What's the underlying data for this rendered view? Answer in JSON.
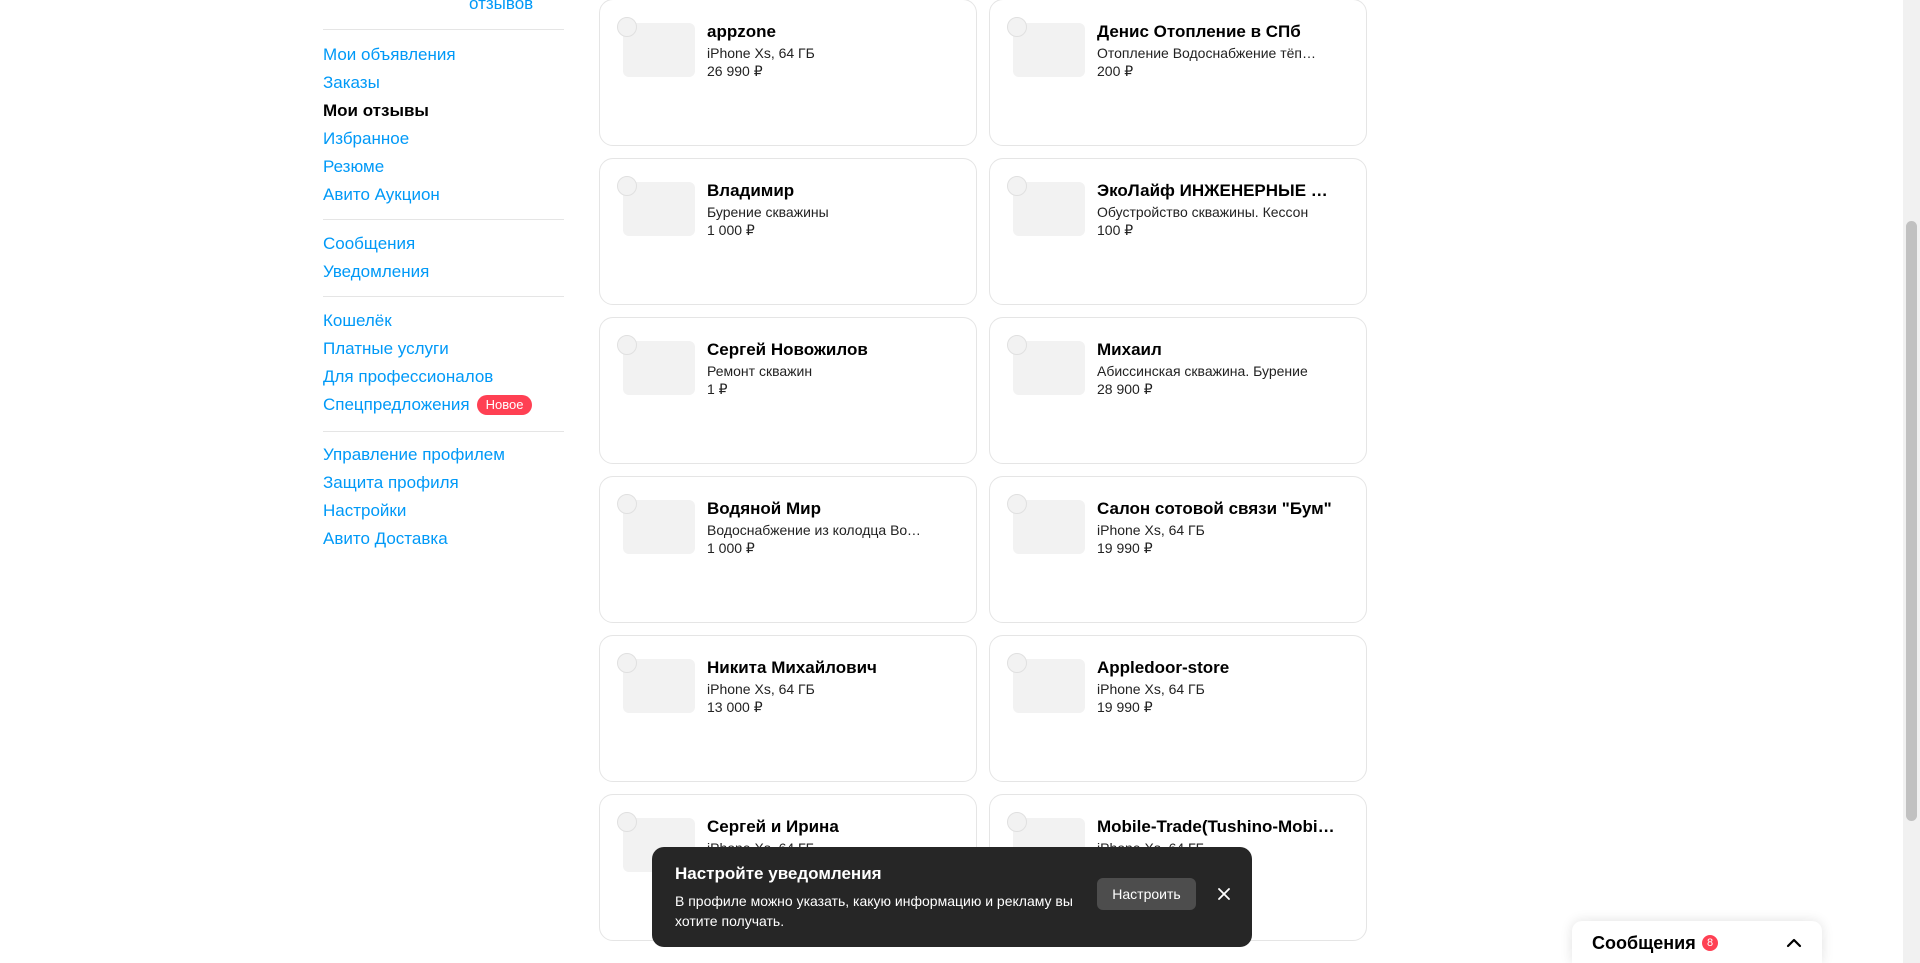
{
  "sidebar": {
    "reviews_link": "отзывов",
    "groups": [
      [
        "Мои объявления",
        "Заказы",
        "Мои отзывы",
        "Избранное",
        "Резюме",
        "Авито Аукцион"
      ],
      [
        "Сообщения",
        "Уведомления"
      ],
      [
        "Кошелёк",
        "Платные услуги",
        "Для профессионалов",
        "Спецпредложения"
      ],
      [
        "Управление профилем",
        "Защита профиля",
        "Настройки",
        "Авито Доставка"
      ]
    ],
    "active_item": "Мои отзывы",
    "new_badge": "Новое"
  },
  "cards": [
    {
      "name": "appzone",
      "title": "iPhone Xs, 64 ГБ",
      "price": "26 990 ₽"
    },
    {
      "name": "Денис Отопление в СПб",
      "title": "Отопление Водоснабжение тёплый пол",
      "price": "200 ₽"
    },
    {
      "name": "Владимир",
      "title": "Бурение скважины",
      "price": "1 000 ₽"
    },
    {
      "name": "ЭкоЛайф ИНЖЕНЕРНЫЕ СИСТЕМЫ",
      "title": "Обустройство скважины. Кессон",
      "price": "100 ₽"
    },
    {
      "name": "Сергей Новожилов",
      "title": "Ремонт скважин",
      "price": "1 ₽"
    },
    {
      "name": "Михаил",
      "title": "Абиссинская скважина. Бурение",
      "price": "28 900 ₽"
    },
    {
      "name": "Водяной Мир",
      "title": "Водоснабжение из колодца Водопровод",
      "price": "1 000 ₽"
    },
    {
      "name": "Салон сотовой связи \"Бум\"",
      "title": "iPhone Xs, 64 ГБ",
      "price": "19 990 ₽"
    },
    {
      "name": "Никита Михайлович",
      "title": "iPhone Xs, 64 ГБ",
      "price": "13 000 ₽"
    },
    {
      "name": "Appledoor-store",
      "title": "iPhone Xs, 64 ГБ",
      "price": "19 990 ₽"
    },
    {
      "name": "Сергей и Ирина",
      "title": "iPhone Xs, 64 ГБ",
      "price": ""
    },
    {
      "name": "Mobile-Trade(Tushino-Mobile)",
      "title": "iPhone Xs, 64 ГБ",
      "price": ""
    }
  ],
  "toast": {
    "title": "Настройте уведомления",
    "text": "В профиле можно указать, какую информацию и рекламу вы хотите получать.",
    "button": "Настроить"
  },
  "messages": {
    "label": "Сообщения",
    "count": "8"
  },
  "colors": {
    "link": "#0099f7",
    "badge": "#ff4053",
    "toast_bg": "#262626"
  }
}
